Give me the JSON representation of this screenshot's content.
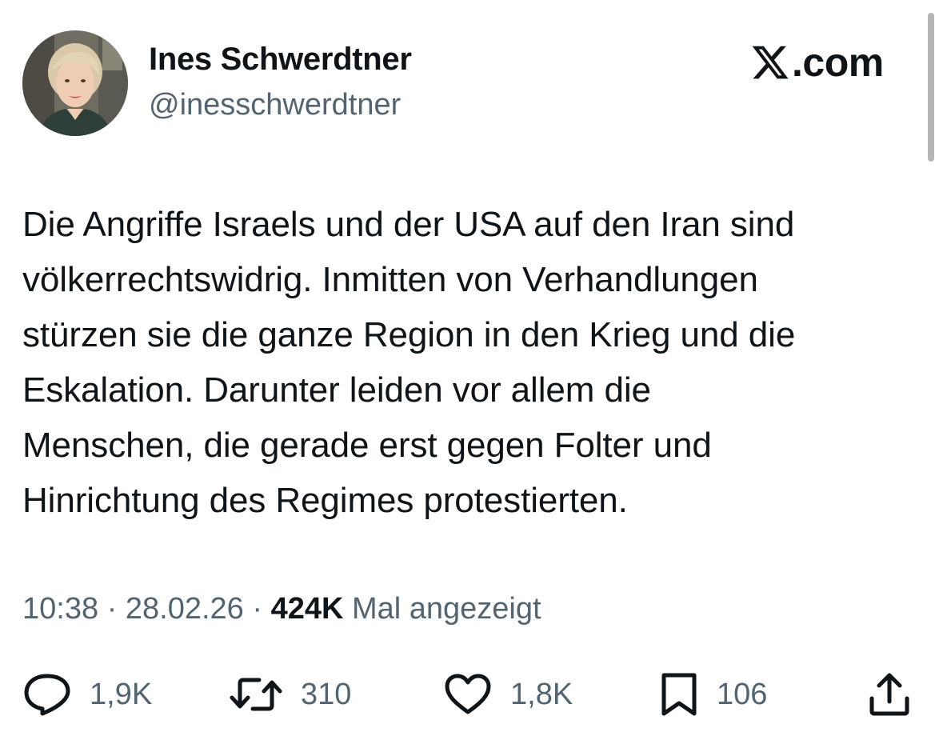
{
  "author": {
    "name": "Ines Schwerdtner",
    "handle": "@inesschwerdtner"
  },
  "brand": {
    "text": ".com",
    "logo_icon": "x-logo-icon"
  },
  "tweet": {
    "text": "Die Angriffe Israels und der USA auf den Iran sind\nvölkerrechtswidrig. Inmitten von Verhandlungen\nstürzen sie die ganze Region in den Krieg und die\nEskalation. Darunter leiden vor allem die\nMenschen, die gerade erst gegen Folter und\nHinrichtung des Regimes protestierten."
  },
  "meta": {
    "time": "10:38",
    "separator": " · ",
    "date": "28.02.26",
    "views_count": "424K",
    "views_label": " Mal angezeigt"
  },
  "actions": {
    "reply": {
      "icon": "reply-icon",
      "count": "1,9K"
    },
    "retweet": {
      "icon": "retweet-icon",
      "count": "310"
    },
    "like": {
      "icon": "heart-icon",
      "count": "1,8K"
    },
    "bookmark": {
      "icon": "bookmark-icon",
      "count": "106"
    },
    "share": {
      "icon": "share-icon"
    }
  },
  "colors": {
    "text": "#0f1419",
    "secondary": "#536471",
    "background": "#ffffff"
  }
}
